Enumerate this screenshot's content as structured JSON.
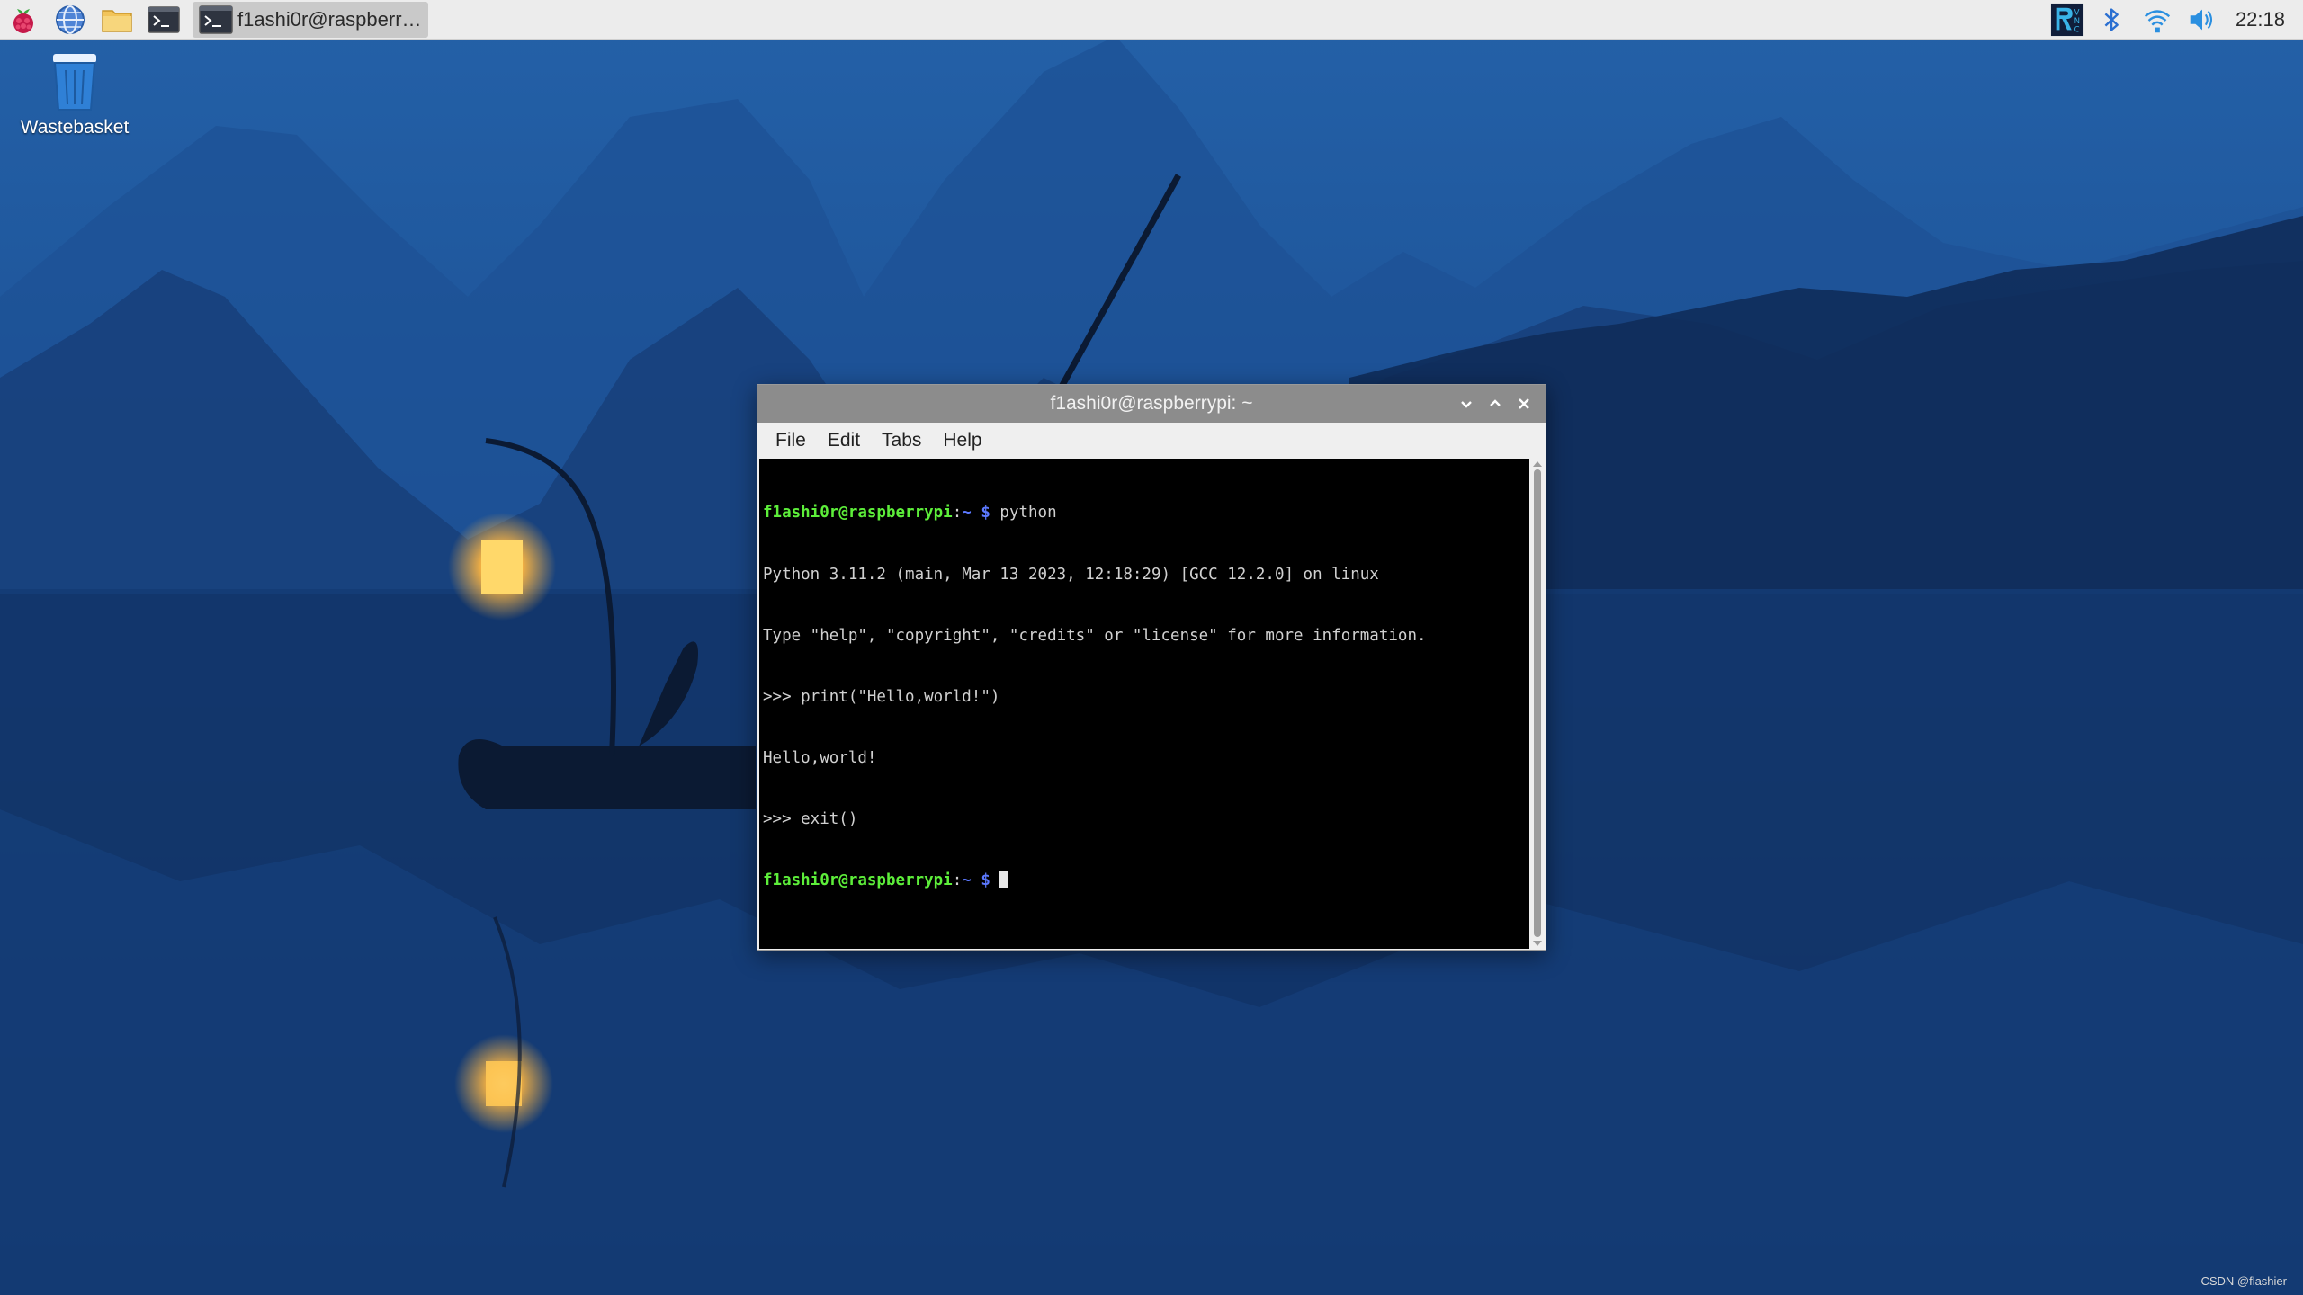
{
  "taskbar": {
    "launchers": [
      {
        "name": "raspberry-menu",
        "icon": "raspberry-icon"
      },
      {
        "name": "web-browser",
        "icon": "globe-icon"
      },
      {
        "name": "file-manager",
        "icon": "folder-icon"
      },
      {
        "name": "terminal-launcher",
        "icon": "terminal-icon"
      }
    ],
    "task_window_label": "f1ashi0r@raspberryp...",
    "tray": {
      "icons": [
        "vnc-icon",
        "bluetooth-icon",
        "wifi-icon",
        "volume-icon"
      ],
      "clock": "22:18"
    }
  },
  "desktop": {
    "icons": [
      {
        "label": "Wastebasket",
        "icon": "trash-icon"
      }
    ]
  },
  "terminal": {
    "title": "f1ashi0r@raspberrypi: ~",
    "menu": [
      "File",
      "Edit",
      "Tabs",
      "Help"
    ],
    "prompt_user": "f1ashi0r@raspberrypi",
    "prompt_colon": ":",
    "prompt_path": "~ $",
    "lines": {
      "cmd1": " python",
      "out1": "Python 3.11.2 (main, Mar 13 2023, 12:18:29) [GCC 12.2.0] on linux",
      "out2": "Type \"help\", \"copyright\", \"credits\" or \"license\" for more information.",
      "out3": ">>> print(\"Hello,world!\")",
      "out4": "Hello,world!",
      "out5": ">>> exit()"
    }
  },
  "watermark": "CSDN @flashier",
  "colors": {
    "panel_bg": "#ececec",
    "titlebar_bg": "#8c8c8c",
    "prompt_user": "#5dee3a",
    "prompt_path": "#5c79ff"
  }
}
